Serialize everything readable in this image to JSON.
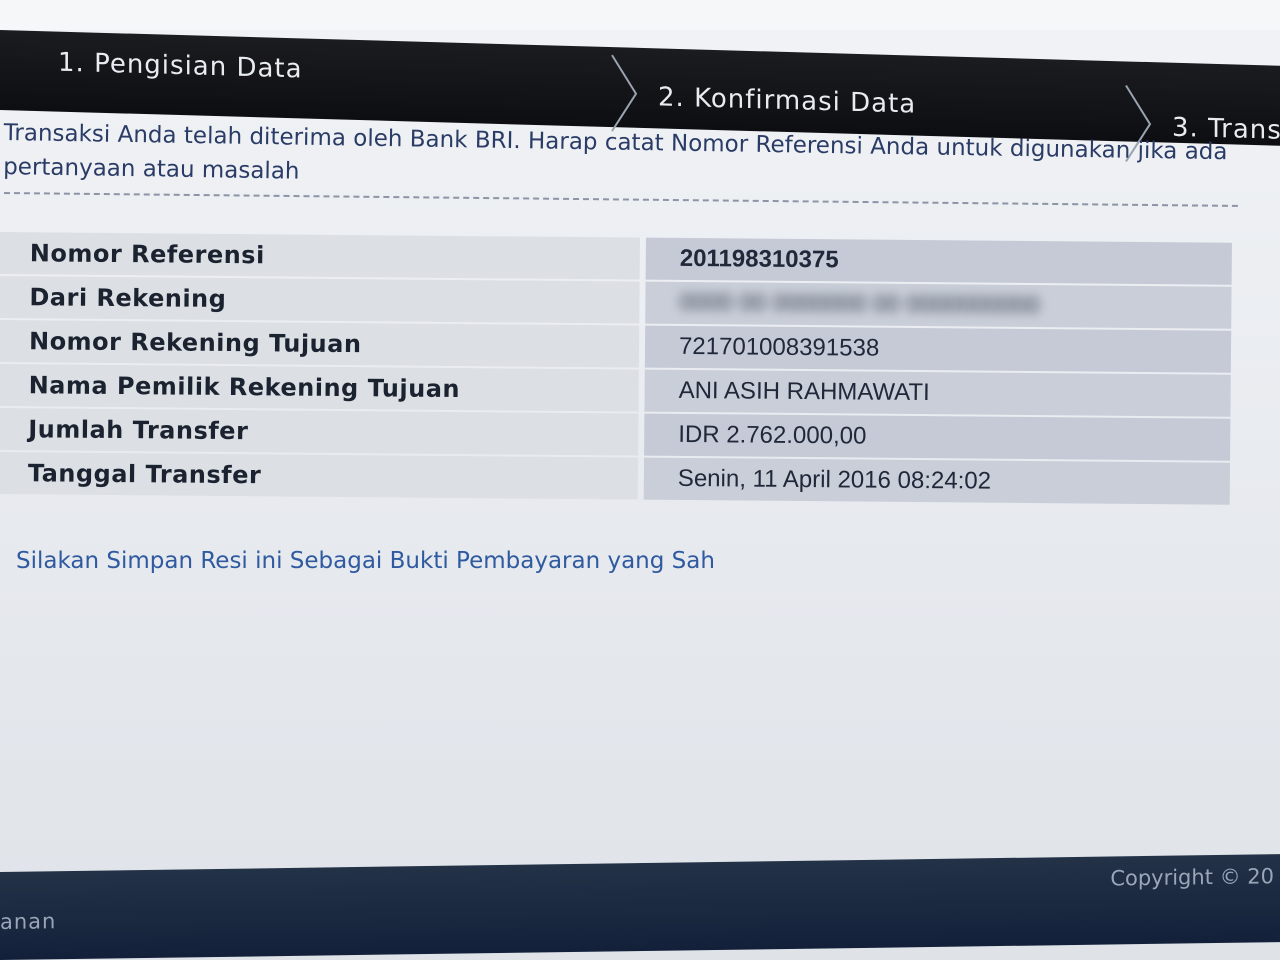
{
  "steps": [
    {
      "label": "1. Pengisian Data"
    },
    {
      "label": "2. Konfirmasi Data"
    },
    {
      "label": "3. Transa"
    }
  ],
  "message": "Transaksi Anda telah diterima oleh Bank BRI. Harap catat Nomor Referensi Anda untuk digunakan jika ada pertanyaan atau masalah",
  "details": [
    {
      "label": "Nomor Referensi",
      "value": "201198310375"
    },
    {
      "label": "Dari Rekening",
      "value": "0000 00 0000000 00 0000000000"
    },
    {
      "label": "Nomor Rekening Tujuan",
      "value": "721701008391538"
    },
    {
      "label": "Nama Pemilik Rekening Tujuan",
      "value": "ANI ASIH RAHMAWATI"
    },
    {
      "label": "Jumlah Transfer",
      "value": "IDR 2.762.000,00"
    },
    {
      "label": "Tanggal Transfer",
      "value": "Senin, 11 April 2016 08:24:02"
    }
  ],
  "note": "Silakan Simpan Resi ini Sebagai Bukti Pembayaran yang Sah",
  "footer": {
    "copyright": "Copyright © 20",
    "left_text": "anan"
  }
}
